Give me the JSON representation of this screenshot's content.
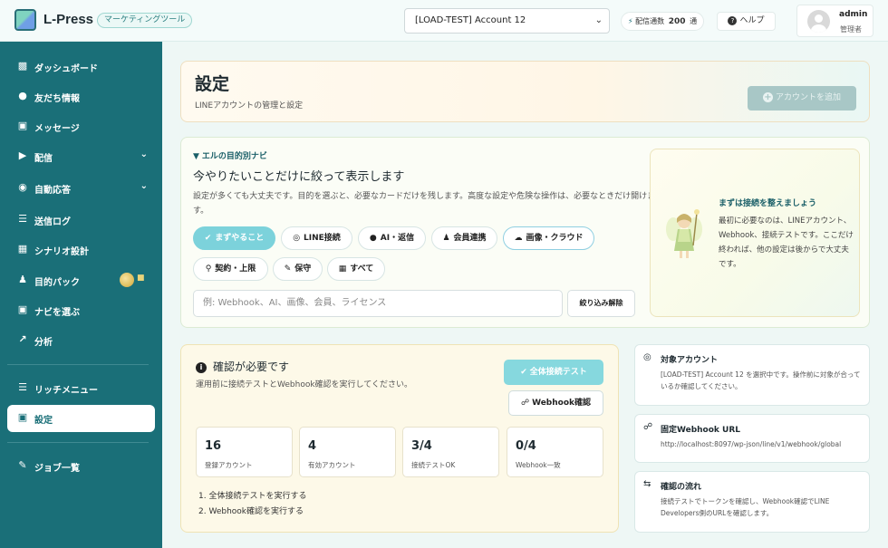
{
  "header": {
    "app_name": "L-Press",
    "app_badge": "マーケティングツール",
    "account_select": "[LOAD-TEST] Account 12",
    "delivery_label": "配信通数",
    "delivery_count": "200",
    "delivery_unit": "通",
    "help_label": "ヘルプ",
    "user_name": "admin",
    "user_role": "管理者"
  },
  "sidebar": {
    "items": [
      {
        "label": "ダッシュボード",
        "icon": "bar-chart-icon"
      },
      {
        "label": "友だち情報",
        "icon": "users-icon"
      },
      {
        "label": "メッセージ",
        "icon": "chat-icon"
      },
      {
        "label": "配信",
        "icon": "megaphone-icon"
      },
      {
        "label": "自動応答",
        "icon": "robot-icon"
      },
      {
        "label": "送信ログ",
        "icon": "list-icon"
      },
      {
        "label": "シナリオ設計",
        "icon": "sitemap-icon"
      },
      {
        "label": "目的パック",
        "icon": "person-icon"
      },
      {
        "label": "ナビを選ぶ",
        "icon": "comment-icon"
      },
      {
        "label": "分析",
        "icon": "line-chart-icon"
      },
      {
        "label": "リッチメニュー",
        "icon": "menu-icon"
      },
      {
        "label": "設定",
        "icon": "settings-box-icon"
      },
      {
        "label": "ジョブ一覧",
        "icon": "wrench-icon"
      }
    ]
  },
  "page": {
    "title": "設定",
    "subtitle": "LINEアカウントの管理と設定",
    "add_account_label": "アカウントを追加"
  },
  "nav_card": {
    "kicker": "エルの目的別ナビ",
    "heading": "今やりたいことだけに絞って表示します",
    "description": "設定が多くても大丈夫です。目的を選ぶと、必要なカードだけを残します。高度な設定や危険な操作は、必要なときだけ開けます。",
    "chips": [
      {
        "label": "まずやること",
        "icon": "check-circle-icon"
      },
      {
        "label": "LINE接続",
        "icon": "globe-icon"
      },
      {
        "label": "AI・返信",
        "icon": "chat-icon"
      },
      {
        "label": "会員連携",
        "icon": "user-icon"
      },
      {
        "label": "画像・クラウド",
        "icon": "cloud-icon"
      },
      {
        "label": "契約・上限",
        "icon": "key-icon"
      },
      {
        "label": "保守",
        "icon": "wrench-icon"
      },
      {
        "label": "すべて",
        "icon": "grid-icon"
      }
    ],
    "search_placeholder": "例: Webhook、AI、画像、会員、ライセンス",
    "clear_label": "絞り込み解除",
    "guide_title": "まずは接続を整えましょう",
    "guide_text": "最初に必要なのは、LINEアカウント、Webhook、接続テストです。ここだけ終われば、他の設定は後からで大丈夫です。"
  },
  "confirm": {
    "title": "確認が必要です",
    "description": "運用前に接続テストとWebhook確認を実行してください。",
    "test_all_label": "全体接続テスト",
    "webhook_label": "Webhook確認",
    "stats": [
      {
        "value": "16",
        "label": "登録アカウント"
      },
      {
        "value": "4",
        "label": "有効アカウント"
      },
      {
        "value": "3/4",
        "label": "接続テストOK"
      },
      {
        "value": "0/4",
        "label": "Webhook一致"
      }
    ],
    "steps": [
      "1. 全体接続テストを実行する",
      "2. Webhook確認を実行する"
    ]
  },
  "info": {
    "target": {
      "title": "対象アカウント",
      "desc": "[LOAD-TEST] Account 12 を選択中です。操作前に対象が合っているか確認してください。"
    },
    "webhook": {
      "title": "固定Webhook URL",
      "desc": "http://localhost:8097/wp-json/line/v1/webhook/global"
    },
    "flow": {
      "title": "確認の流れ",
      "desc": "接続テストでトークンを確認し、Webhook確認でLINE Developers側のURLを確認します。"
    }
  }
}
